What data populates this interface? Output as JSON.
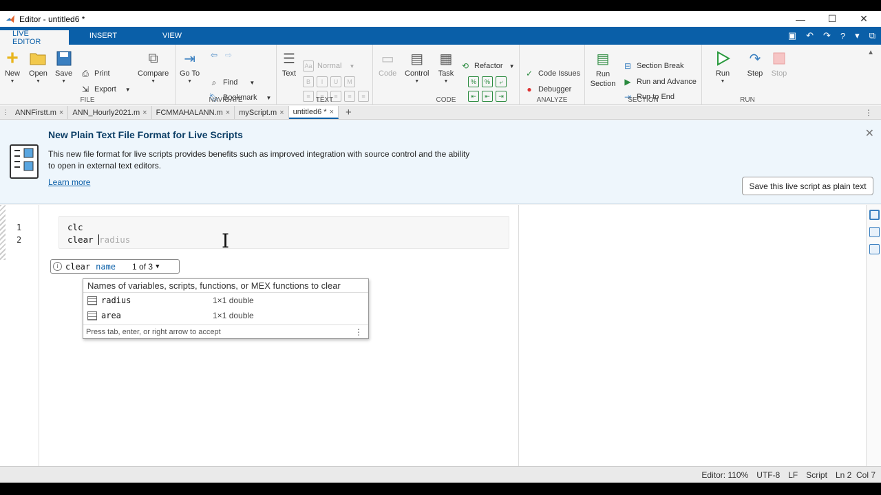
{
  "window": {
    "title": "Editor - untitled6 *",
    "controls": [
      "—",
      "☐",
      "✕"
    ]
  },
  "ribbon_tabs": [
    "LIVE EDITOR",
    "INSERT",
    "VIEW"
  ],
  "ribbon": {
    "file": {
      "label": "FILE",
      "new": "New",
      "open": "Open",
      "save": "Save",
      "print": "Print",
      "export": "Export",
      "compare": "Compare"
    },
    "navigate": {
      "label": "NAVIGATE",
      "goto": "Go To",
      "find": "Find",
      "bookmark": "Bookmark"
    },
    "text": {
      "label": "TEXT",
      "text": "Text",
      "normal": "Normal"
    },
    "code": {
      "label": "CODE",
      "code": "Code",
      "control": "Control",
      "task": "Task",
      "refactor": "Refactor"
    },
    "analyze": {
      "label": "ANALYZE",
      "code_issues": "Code Issues",
      "debugger": "Debugger"
    },
    "section": {
      "label": "SECTION",
      "run_section": "Run Section",
      "section_break": "Section Break",
      "run_and_advance": "Run and Advance",
      "run_to_end": "Run to End"
    },
    "run": {
      "label": "RUN",
      "run": "Run",
      "step": "Step",
      "stop": "Stop"
    }
  },
  "doc_tabs": [
    {
      "label": "ANNFirstt.m",
      "active": false
    },
    {
      "label": "ANN_Hourly2021.m",
      "active": false
    },
    {
      "label": "FCMMAHALANN.m",
      "active": false
    },
    {
      "label": "myScript.m",
      "active": false
    },
    {
      "label": "untitled6 *",
      "active": true
    }
  ],
  "banner": {
    "title": "New Plain Text File Format for Live Scripts",
    "text": "This new file format for live scripts provides benefits such as improved integration with source control and the ability to open in external text editors.",
    "link": "Learn more",
    "save_button": "Save this live script as plain text"
  },
  "editor": {
    "line_numbers": [
      "1",
      "2"
    ],
    "lines": {
      "l1": "clc",
      "l2_typed": "clear ",
      "l2_ghost": "radius"
    }
  },
  "signature_hint": {
    "keyword": "clear",
    "arg": "name",
    "count": "1 of 3"
  },
  "completion": {
    "header": "Names of variables, scripts, functions, or MEX functions to clear",
    "items": [
      {
        "name": "radius",
        "type": "1×1 double"
      },
      {
        "name": "area",
        "type": "1×1 double"
      }
    ],
    "footer": "Press tab, enter, or right arrow to accept"
  },
  "status": {
    "zoom": "Editor: 110%",
    "encoding": "UTF-8",
    "eol": "LF",
    "type": "Script",
    "position": "Ln 2  Col 7"
  }
}
